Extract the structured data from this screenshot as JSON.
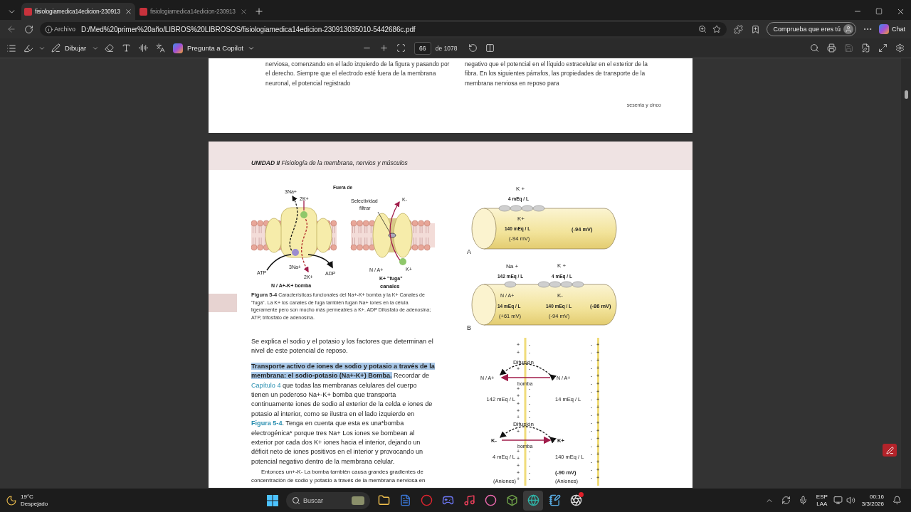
{
  "browser_tabs": [
    {
      "title": "fisiologiamedica14edicion-230913",
      "selected": true
    },
    {
      "title": "fisiologiamedica14edicion-230913",
      "selected": false
    }
  ],
  "address_bar": {
    "scheme_label": "Archivo",
    "url": "D:/Med%20primer%20año/LIBROS%20LIBROSOS/fisiologiamedica14edicion-230913035010-5442686c.pdf"
  },
  "profile_button": "Comprueba que eres tú",
  "chat_button": "Chat",
  "pdf_toolbar": {
    "draw_label": "Dibujar",
    "copilot_label": "Pregunta a Copilot",
    "page_number": "66",
    "page_count": "de 1078"
  },
  "previous_page": {
    "left_column": "nerviosa, comenzando en el lado izquierdo de la figura y pasando por el derecho. Siempre que el electrodo esté fuera de la membrana neuronal, el potencial registrado",
    "right_column": "negativo que el potencial en el líquido extracelular en el exterior de la fibra. En los siguientes párrafos, las propiedades de transporte de la membrana nerviosa en reposo para",
    "page_footer": "sesenta y cinco"
  },
  "page": {
    "running_head": "**UNIDAD II** Fisiología de la membrana, nervios y músculos",
    "figure": {
      "outside_label": "Fuera de",
      "pump_na_out": "3Na+",
      "pump_k_in": "2K+",
      "pump_atp": "ATP",
      "pump_na_in": "3Na+",
      "pump_k_out": "2K+",
      "pump_adp": "ADP",
      "pump_title": "N / A+-K+ bomba",
      "filter_label_1": "Selectividad",
      "filter_label_2": "filtrar",
      "channel_k_out": "K-",
      "channel_na": "N / A+",
      "channel_k_in": "K+",
      "channel_title_1": "K+ \"fuga\"",
      "channel_title_2": "canales"
    },
    "caption": "**Figura 5-4** Características funcionales del Na+-K+ bomba y la K+ Canales de \"fuga\". La K+ los canales de fuga también fugan Na+ iones en la célula ligeramente pero son mucho más permeables a K+. ADP Difosfato de adenosina; ATP, trifosfato de adenosina.",
    "paragraphs": [
      {
        "kind": "plain",
        "segments": [
          {
            "kind": "text",
            "text": "Se explica el sodio y el potasio y los factores que determinan el nivel de este potencial de reposo."
          }
        ]
      },
      {
        "kind": "plain",
        "segments": [
          {
            "kind": "heading",
            "text": "Transporte activo de iones de sodio y potasio a través de la membrana: el sodio-potasio (Na+-K+) Bomba."
          },
          {
            "kind": "text",
            "text": " Recordar de "
          },
          {
            "kind": "link",
            "text": "Capítulo 4"
          },
          {
            "kind": "text",
            "text": " que todas las membranas celulares del cuerpo tienen un poderoso Na+-K+ bomba que transporta continuamente iones de sodio al exterior de la celda e iones de potasio al interior, como se ilustra en el lado izquierdo en "
          },
          {
            "kind": "figure_link",
            "text": "Figura 5-4"
          },
          {
            "kind": "text",
            "text": ". Tenga en cuenta que esta es una*bomba electrogénica* porque tres Na+ Los iones se bombean al exterior por cada dos K+ iones hacia el interior, dejando un déficit neto de iones positivos en el interior y provocando un potencial negativo dentro de la membrana celular."
          }
        ]
      },
      {
        "kind": "small",
        "segments": [
          {
            "kind": "text",
            "text": "Entonces un+-K- La bomba también causa grandes gradientes de concentración de sodio y potasio a través de la membrana nerviosa en"
          }
        ]
      }
    ],
    "cylinders": {
      "a_k_out": "K +",
      "a_k_out_conc": "4 mEq / L",
      "a_k_in": "K+",
      "a_k_in_conc": "140 mEq / L",
      "a_k_potential": "(-94 mV)",
      "a_total": "(-94 mV)",
      "a_label": "A",
      "b_na_out": "Na +",
      "b_na_out_conc": "142 mEq / L",
      "b_k_out": "K +",
      "b_k_out_conc": "4 mEq / L",
      "b_na_in": "N / A+",
      "b_na_in_conc": "14 mEq / L",
      "b_na_potential": "(+61 mV)",
      "b_k_in": "K-",
      "b_k_in_conc": "140 mEq / L",
      "b_k_potential": "(-94 mV)",
      "b_total": "(-86 mV)",
      "b_label": "B"
    },
    "transport": {
      "diffusion_1": "Difusión",
      "na_left": "N / A+",
      "na_right": "N / A+",
      "pump_1": "bomba",
      "na_out_conc": "142 mEq / L",
      "na_in_conc": "14 mEq / L",
      "diffusion_2": "Difusión",
      "k_left": "K-",
      "k_right": "K+",
      "pump_2": "bomba",
      "k_out_conc": "4 mEq / L",
      "k_in_conc": "140 mEq / L",
      "potential": "(-90 mV)",
      "anions_out": "(Aniones)",
      "anions_in": "(Aniones)",
      "left_charges": [
        {
          "outer": "+",
          "inner": "-"
        },
        {
          "outer": "+",
          "inner": "-"
        },
        {
          "outer": "+",
          "inner": "-"
        },
        {
          "outer": "+",
          "inner": "-"
        },
        {
          "outer": "+",
          "inner": "-"
        },
        {
          "outer": "+",
          "inner": "-"
        },
        {
          "outer": "+",
          "inner": "-"
        },
        {
          "outer": "+",
          "inner": "-"
        },
        {
          "outer": "+",
          "inner": "-"
        },
        {
          "outer": "+",
          "inner": "-"
        },
        {
          "outer": "+",
          "inner": "-"
        },
        {
          "outer": "+",
          "inner": "-"
        },
        {
          "outer": "+",
          "inner": "-"
        },
        {
          "outer": "+",
          "inner": "-"
        }
      ],
      "right_charges": [
        {
          "outer": "-",
          "inner": "+"
        },
        {
          "outer": "-",
          "inner": "+"
        },
        {
          "outer": "-",
          "inner": "+"
        },
        {
          "outer": "-",
          "inner": "+"
        },
        {
          "outer": "-",
          "inner": "+"
        },
        {
          "outer": "-",
          "inner": "+"
        },
        {
          "outer": "-",
          "inner": "+"
        },
        {
          "outer": "-",
          "inner": "+"
        },
        {
          "outer": "-",
          "inner": "+"
        },
        {
          "outer": "-",
          "inner": "+"
        },
        {
          "outer": "-",
          "inner": "+"
        },
        {
          "outer": "-",
          "inner": "+"
        },
        {
          "outer": "-",
          "inner": "+"
        },
        {
          "outer": "-",
          "inner": "+"
        },
        {
          "outer": "-",
          "inner": "+"
        },
        {
          "outer": "-",
          "inner": "+"
        },
        {
          "outer": "-",
          "inner": "+"
        },
        {
          "outer": "-",
          "inner": "+"
        }
      ]
    }
  },
  "taskbar": {
    "weather_temp": "19°C",
    "weather_desc": "Despejado",
    "search_placeholder": "Buscar",
    "language": "ESP",
    "layout": "LAA",
    "time": "00:16",
    "date": "3/3/2026",
    "apps": [
      {
        "kind": "folder",
        "selected": false,
        "notification": false
      },
      {
        "kind": "document",
        "selected": false,
        "notification": false
      },
      {
        "kind": "ring",
        "selected": false,
        "notification": false
      },
      {
        "kind": "chat",
        "selected": false,
        "notification": false
      },
      {
        "kind": "music",
        "selected": false,
        "notification": false
      },
      {
        "kind": "circle",
        "selected": false,
        "notification": false
      },
      {
        "kind": "cube",
        "selected": false,
        "notification": false
      },
      {
        "kind": "browser",
        "selected": true,
        "notification": false
      },
      {
        "kind": "notepad",
        "selected": false,
        "notification": false
      },
      {
        "kind": "aperture",
        "selected": false,
        "notification": true
      }
    ]
  }
}
